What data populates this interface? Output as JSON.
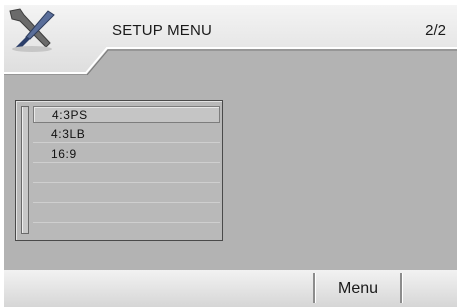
{
  "header": {
    "title": "SETUP MENU",
    "page_indicator": "2/2",
    "icon": "tools-icon"
  },
  "list": {
    "items": [
      {
        "label": "4:3PS",
        "selected": true
      },
      {
        "label": "4:3LB",
        "selected": false
      },
      {
        "label": "16:9",
        "selected": false
      },
      {
        "label": "",
        "selected": false
      },
      {
        "label": "",
        "selected": false
      },
      {
        "label": "",
        "selected": false
      }
    ]
  },
  "footer": {
    "menu_label": "Menu"
  },
  "colors": {
    "background": "#b3b3b3",
    "bar_light": "#f2f2f2",
    "text": "#1a1a1a"
  }
}
